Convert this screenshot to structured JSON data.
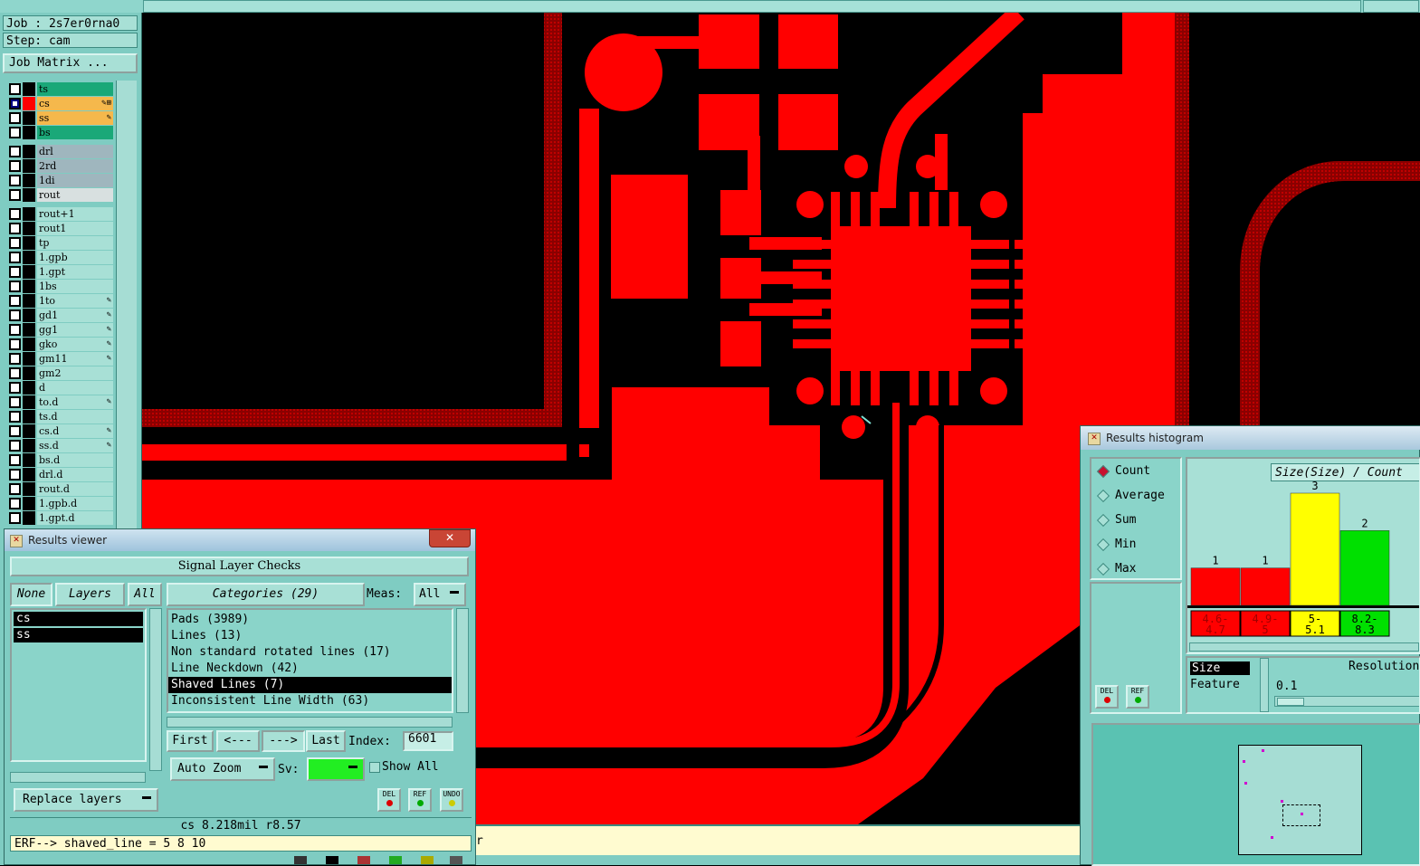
{
  "colors": {
    "copper": "#ff0000",
    "board": "#000000",
    "panel": "#7fccc2",
    "accent_yellow": "#ffff00",
    "accent_green": "#00e000"
  },
  "job": {
    "job_label": "Job : 2s7er0rna0",
    "step_label": "Step: cam",
    "matrix_button": "Job Matrix ..."
  },
  "layers": {
    "group1": [
      {
        "name": "ts",
        "color": "#1aa878",
        "sw": "#000000",
        "sel": false,
        "mark": ""
      },
      {
        "name": "cs",
        "color": "#f5b84c",
        "sw": "#ff0000",
        "sel": true,
        "mark": "✎⊞"
      },
      {
        "name": "ss",
        "color": "#f5b84c",
        "sw": "#000000",
        "sel": false,
        "mark": "✎"
      },
      {
        "name": "bs",
        "color": "#1aa878",
        "sw": "#000000",
        "sel": false,
        "mark": ""
      }
    ],
    "group2": [
      {
        "name": "drl",
        "color": "#9fb6be",
        "mark": ""
      },
      {
        "name": "2rd",
        "color": "#9fb6be",
        "mark": ""
      },
      {
        "name": "1di",
        "color": "#9fb6be",
        "mark": ""
      },
      {
        "name": "rout",
        "color": "#d8e0e0",
        "mark": ""
      }
    ],
    "group3": [
      {
        "name": "rout+1",
        "mark": ""
      },
      {
        "name": "rout1",
        "mark": ""
      },
      {
        "name": "tp",
        "mark": ""
      },
      {
        "name": "1.gpb",
        "mark": ""
      },
      {
        "name": "1.gpt",
        "mark": ""
      },
      {
        "name": "1bs",
        "mark": ""
      },
      {
        "name": "1to",
        "mark": "✎"
      },
      {
        "name": "gd1",
        "mark": "✎"
      },
      {
        "name": "gg1",
        "mark": "✎"
      },
      {
        "name": "gko",
        "mark": "✎"
      },
      {
        "name": "gm11",
        "mark": "✎"
      },
      {
        "name": "gm2",
        "mark": ""
      },
      {
        "name": "d",
        "mark": ""
      },
      {
        "name": "to.d",
        "mark": "✎"
      },
      {
        "name": "ts.d",
        "mark": ""
      },
      {
        "name": "cs.d",
        "mark": "✎"
      },
      {
        "name": "ss.d",
        "mark": "✎"
      },
      {
        "name": "bs.d",
        "mark": ""
      },
      {
        "name": "drl.d",
        "mark": ""
      },
      {
        "name": "rout.d",
        "mark": ""
      },
      {
        "name": "1.gpb.d",
        "mark": ""
      },
      {
        "name": "1.gpt.d",
        "mark": ""
      }
    ]
  },
  "results_viewer": {
    "title": "Results viewer",
    "close": "✕",
    "header": "Signal Layer Checks",
    "btn_none": "None",
    "btn_layers": "Layers",
    "btn_all": "All",
    "layer_items": [
      "cs",
      "ss"
    ],
    "categories_button": "Categories (29)",
    "meas_label": "Meas:",
    "meas_value": "All",
    "categories": [
      {
        "text": "Pads (3989)",
        "sel": false
      },
      {
        "text": "Lines (13)",
        "sel": false
      },
      {
        "text": "Non standard rotated lines (17)",
        "sel": false
      },
      {
        "text": "Line Neckdown (42)",
        "sel": false
      },
      {
        "text": "Shaved Lines (7)",
        "sel": true
      },
      {
        "text": "Inconsistent Line Width (63)",
        "sel": false
      }
    ],
    "btn_first": "First",
    "btn_prev": "<---",
    "btn_next": "--->",
    "btn_last": "Last",
    "index_label": "Index:",
    "index_value": "6601",
    "auto_zoom": "Auto Zoom",
    "sv_label": "Sv:",
    "show_all": "Show All",
    "replace_layers": "Replace layers",
    "icon_del": "DEL",
    "icon_ref": "REF",
    "icon_undo": "UNDO",
    "status": "cs 8.218mil  r8.57",
    "erf": "ERF--> shaved_line = 5 8 10"
  },
  "cmd_strip": {
    "text": "r"
  },
  "histogram": {
    "title": "Results histogram",
    "modes": [
      {
        "label": "Count",
        "on": true
      },
      {
        "label": "Average",
        "on": false
      },
      {
        "label": "Sum",
        "on": false
      },
      {
        "label": "Min",
        "on": false
      },
      {
        "label": "Max",
        "on": false
      }
    ],
    "icon_del": "DEL",
    "icon_ref": "REF",
    "chart_title": "Size(Size) / Count",
    "size_item": "Size",
    "feature_item": "Feature",
    "resolution_label": "Resolution",
    "resolution_value": "0.1"
  },
  "chart_data": {
    "type": "bar",
    "title": "Size(Size) / Count",
    "categories": [
      "4.6-4.7",
      "4.9-5",
      "5-5.1",
      "8.2-8.3"
    ],
    "category_lines": [
      [
        "4.6-",
        "4.7"
      ],
      [
        "4.9-",
        "5"
      ],
      [
        "5-",
        "5.1"
      ],
      [
        "8.2-",
        "8.3"
      ]
    ],
    "values": [
      1,
      1,
      3,
      2
    ],
    "bar_colors": [
      "#ff0000",
      "#ff0000",
      "#ffff00",
      "#00e000"
    ],
    "ylim": [
      0,
      3
    ]
  }
}
